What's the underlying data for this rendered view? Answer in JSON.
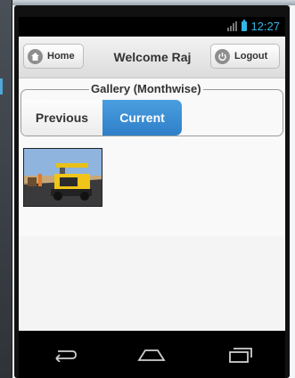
{
  "statusbar": {
    "time": "12:27",
    "network_icon": "3g-icon",
    "battery_icon": "battery-icon"
  },
  "header": {
    "home_label": "Home",
    "title": "Welcome Raj",
    "logout_label": "Logout"
  },
  "gallery": {
    "legend": "Gallery (Monthwise)",
    "tabs": [
      {
        "label": "Previous",
        "selected": false
      },
      {
        "label": "Current",
        "selected": true
      }
    ],
    "thumbnails": [
      {
        "subject": "yellow road paver machine on asphalt"
      }
    ]
  },
  "navbar": {
    "buttons": [
      "back-icon",
      "home-icon",
      "recent-apps-icon"
    ]
  },
  "colors": {
    "accent": "#3088d0",
    "status": "#33b5e5"
  }
}
